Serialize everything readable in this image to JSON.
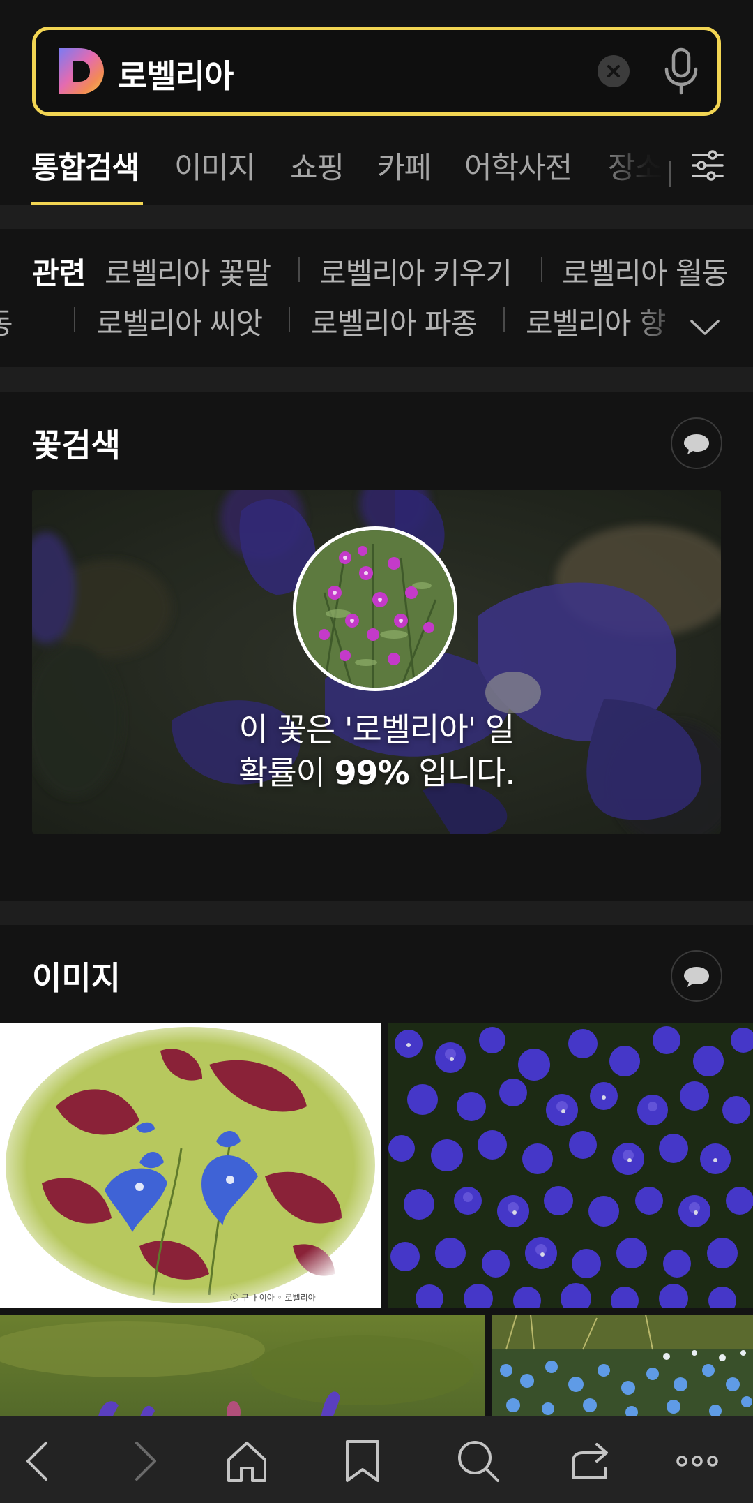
{
  "search": {
    "query": "로벨리아"
  },
  "tabs": [
    {
      "label": "통합검색",
      "active": true
    },
    {
      "label": "이미지"
    },
    {
      "label": "쇼핑"
    },
    {
      "label": "카페"
    },
    {
      "label": "어학사전"
    },
    {
      "label": "장소"
    }
  ],
  "related": {
    "label": "관련",
    "items": [
      "로벨리아 꽃말",
      "로벨리아 키우기",
      "로벨리아 월동",
      "로벨리아 씨앗",
      "로벨리아 파종",
      "로벨리아 향"
    ]
  },
  "flower_search": {
    "title": "꽃검색",
    "result_line1": "이 꽃은 '로벨리아' 일",
    "result_line2_prefix": "확률이 ",
    "probability": "99%",
    "result_line2_suffix": " 입니다."
  },
  "images_section": {
    "title": "이미지",
    "watermark": "ⓒ 구 ㅏ이아 ◦ 로벨리아"
  },
  "colors": {
    "accent": "#f2d553",
    "background": "#131313",
    "section_gap": "#1e1e1e",
    "nav_background": "#232323"
  },
  "icons": [
    "daum-logo",
    "clear-icon",
    "mic-icon",
    "filter-icon",
    "chevron-down-icon",
    "feedback-icon",
    "back-icon",
    "forward-icon",
    "home-icon",
    "bookmark-icon",
    "search-icon",
    "share-icon",
    "more-icon"
  ]
}
